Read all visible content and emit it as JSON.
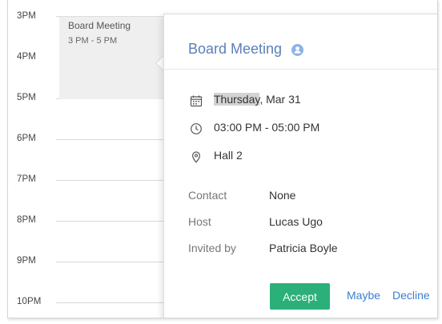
{
  "calendar": {
    "hours": [
      "3PM",
      "4PM",
      "5PM",
      "6PM",
      "7PM",
      "8PM",
      "9PM",
      "10PM"
    ]
  },
  "event": {
    "title": "Board Meeting",
    "time_range": "3 PM - 5 PM"
  },
  "popover": {
    "title": "Board Meeting",
    "date_weekday": "Thursday",
    "date_rest": ", Mar 31",
    "time": "03:00 PM - 05:00 PM",
    "location": "Hall 2",
    "details": {
      "contact_label": "Contact",
      "contact_value": "None",
      "host_label": "Host",
      "host_value": "Lucas Ugo",
      "invited_label": "Invited by",
      "invited_value": "Patricia Boyle"
    },
    "actions": {
      "accept": "Accept",
      "maybe": "Maybe",
      "decline": "Decline"
    }
  },
  "colors": {
    "accent_title": "#5b7fb8",
    "accept_green": "#2bb079",
    "link_blue": "#3a7fd0"
  },
  "icons": [
    "person-icon",
    "calendar-icon",
    "clock-icon",
    "location-pin-icon"
  ]
}
